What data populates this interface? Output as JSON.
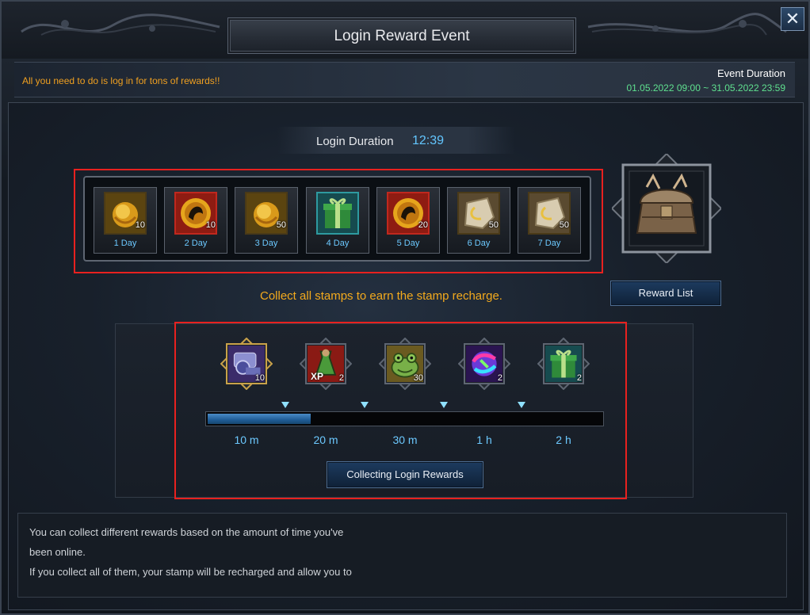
{
  "window": {
    "title": "Login Reward Event",
    "close_icon": "close-icon"
  },
  "info": {
    "tagline": "All you need to do is log in for tons of rewards!!",
    "event_duration_label": "Event Duration",
    "event_duration_value": "01.05.2022 09:00 ~ 31.05.2022 23:59"
  },
  "login_duration": {
    "label": "Login Duration",
    "value": "12:39"
  },
  "stamps": [
    {
      "day": "1 Day",
      "count": "10",
      "icon": "gold-orb-icon"
    },
    {
      "day": "2 Day",
      "count": "10",
      "icon": "gold-emblem-icon"
    },
    {
      "day": "3 Day",
      "count": "50",
      "icon": "gold-orb-icon"
    },
    {
      "day": "4 Day",
      "count": "",
      "icon": "green-gift-box-icon"
    },
    {
      "day": "5 Day",
      "count": "20",
      "icon": "gold-emblem-icon"
    },
    {
      "day": "6 Day",
      "count": "50",
      "icon": "stone-rune-icon"
    },
    {
      "day": "7 Day",
      "count": "50",
      "icon": "stone-rune-icon"
    }
  ],
  "chest_icon": "wooden-chest-icon",
  "reward_list_button": "Reward List",
  "collect_note": "Collect all stamps to earn the stamp recharge.",
  "time_rewards": [
    {
      "time": "10 m",
      "count": "10",
      "icon": "scroll-bundle-icon"
    },
    {
      "time": "20 m",
      "count": "2",
      "icon": "xp-potion-icon"
    },
    {
      "time": "30 m",
      "count": "30",
      "icon": "frog-icon"
    },
    {
      "time": "1 h",
      "count": "2",
      "icon": "magic-orb-icon"
    },
    {
      "time": "2 h",
      "count": "2",
      "icon": "green-gift-box-icon"
    }
  ],
  "xp_badge": "XP",
  "progress_fraction": 0.26,
  "collect_button": "Collecting Login Rewards",
  "description": [
    "You can collect different rewards based on the amount of time you've",
    "been online.",
    "If you collect all of them, your stamp will be recharged and allow you to"
  ]
}
